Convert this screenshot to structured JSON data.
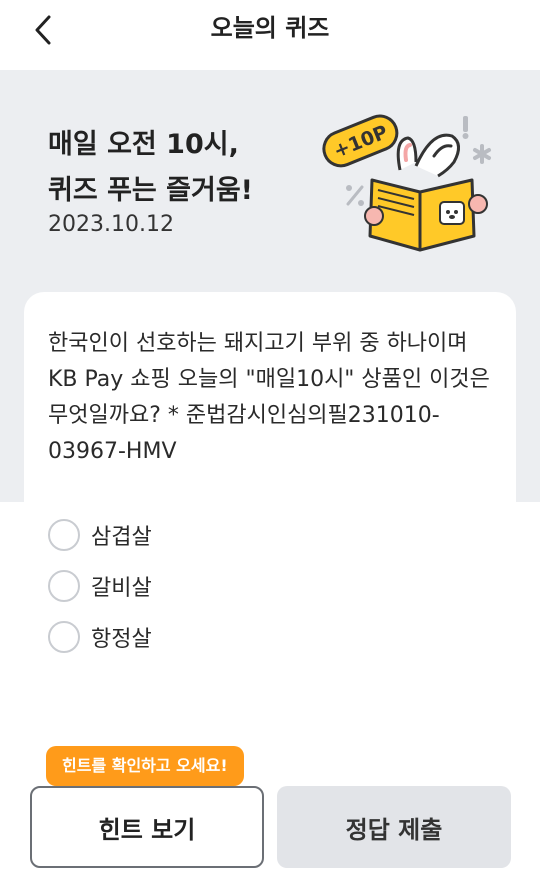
{
  "header": {
    "title": "오늘의 퀴즈",
    "back_icon": "chevron-left-icon"
  },
  "hero": {
    "title_lines": [
      "매일 오전 10시,",
      "퀴즈 푸는 즐거움!"
    ],
    "date": "2023.10.12",
    "badge": "+10P"
  },
  "question": {
    "lines": [
      "한국인이 선호하는 돼지고기 부위 중 하나이며",
      "KB Pay 쇼핑 오늘의 \"매일10시\" 상품인 이것은",
      "무엇일까요? * 준법감시인심의필231010-",
      "03967-HMV"
    ]
  },
  "options": [
    {
      "label": "삼겹살",
      "selected": false
    },
    {
      "label": "갈비살",
      "selected": false
    },
    {
      "label": "항정살",
      "selected": false
    }
  ],
  "tooltip": {
    "text": "힌트를 확인하고 오세요!"
  },
  "buttons": {
    "hint": "힌트 보기",
    "submit": "정답 제출"
  },
  "colors": {
    "accent": "#ff9b1a",
    "hero_bg": "#eceef1",
    "book_yellow": "#ffc928",
    "submit_disabled": "#e2e4e8"
  }
}
